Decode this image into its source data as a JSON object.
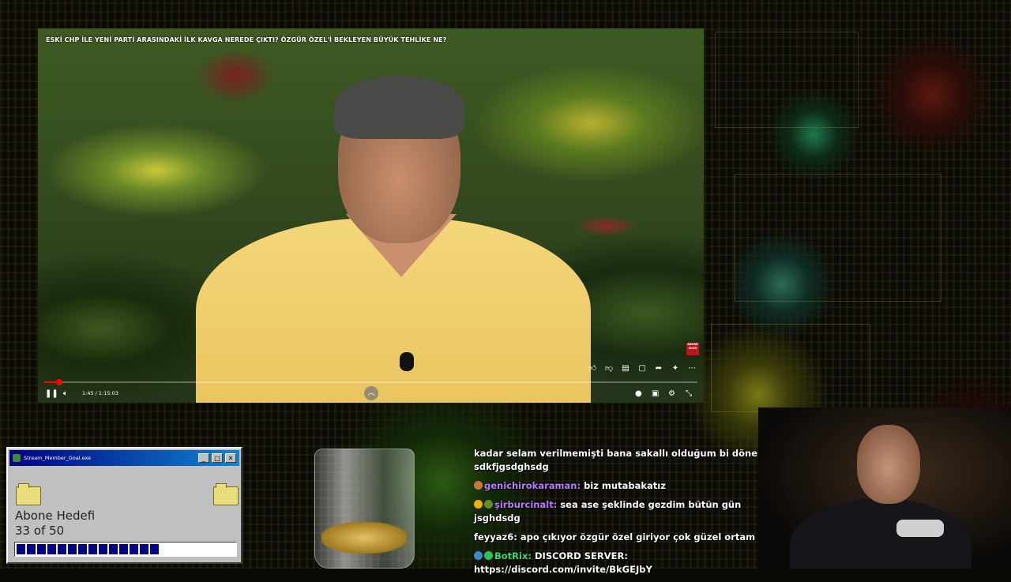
{
  "video": {
    "title": "ESKİ CHP İLE YENİ PARTİ ARASINDAKİ İLK KAVGA NEREDE ÇIKTI? ÖZGÜR ÖZEL'İ BEKLEYEN BÜYÜK TEHLİKE NE?",
    "time": "1:45 / 1:15:03",
    "progress_fraction": 0.023,
    "subscribe_badge": "ABONE OLUN",
    "icons": {
      "like": "thumbs-up-icon",
      "dislike": "thumbs-down-icon",
      "comment": "comment-icon",
      "chat": "chat-icon",
      "share": "share-icon",
      "ask": "sparkle-icon",
      "more": "more-icon",
      "play_pause": "pause-icon",
      "volume": "volume-icon",
      "expand": "chevron-up-icon",
      "autoplay": "autoplay-icon",
      "captions": "captions-icon",
      "settings": "gear-icon",
      "fullscreen": "fullscreen-icon"
    }
  },
  "goal_window": {
    "title": "Stream_Member_Goal.exe",
    "label": "Abone Hedefi",
    "count_text": "33 of 50",
    "current": 33,
    "target": 50,
    "buttons": {
      "minimize": "_",
      "maximize": "□",
      "close": "✕"
    }
  },
  "chat": {
    "messages": [
      {
        "user": "",
        "text": "kadar selam verilmemişti bana sakallı olduğum bi dönemdi sdkfjgsdghsdg"
      },
      {
        "user": "genichirokaraman:",
        "text": " biz mutabakatız"
      },
      {
        "user": "şirburcinalt:",
        "text": " sea ase şeklinde gezdim bütün gün jsghdsdg"
      },
      {
        "user": "feyyaz6:",
        "text": " apo çıkıyor özgür özel giriyor çok güzel ortam"
      },
      {
        "user": "BotRix:",
        "text": " DISCORD SERVER: https://discord.com/invite/BkGEJbY"
      }
    ]
  },
  "colors": {
    "goal_bar": "#000080",
    "win_title": "#000080",
    "progress": "#ff0000",
    "chat_user": "#b87aff",
    "bot_user": "#2ee06a"
  }
}
